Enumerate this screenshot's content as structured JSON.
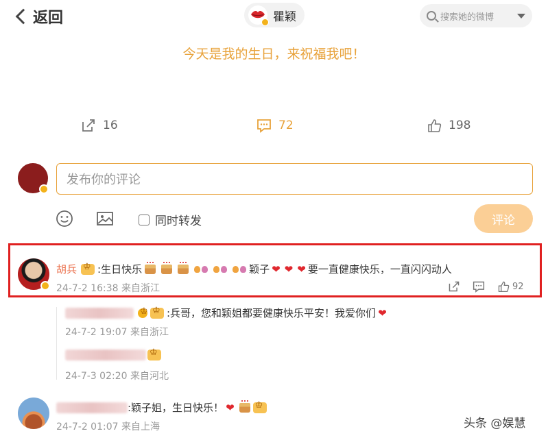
{
  "header": {
    "back_label": "返回",
    "user_name": "瞿颖",
    "search_placeholder": "搜索她的微博"
  },
  "post": {
    "text": "今天是我的生日，来祝福我吧！"
  },
  "actions": {
    "repost_count": "16",
    "comment_count": "72",
    "like_count": "198"
  },
  "composer": {
    "placeholder": "发布你的评论",
    "repost_label": "同时转发",
    "submit_label": "评论"
  },
  "comments": [
    {
      "author": "胡兵",
      "text_prefix": ":生日快乐",
      "text_name": "颖子",
      "text_suffix": "要一直健康快乐，一直闪闪动人",
      "time": "24-7-2 16:38 来自浙江",
      "likes": "92",
      "replies": [
        {
          "text": ":兵哥，您和颖姐都要健康快乐平安！我爱你们",
          "time": "24-7-2 19:07 来自浙江"
        },
        {
          "text": "",
          "time": "24-7-3 02:20 来自河北"
        }
      ]
    },
    {
      "author": "",
      "text": ":颖子姐，生日快乐！",
      "time": "24-7-2 01:07 来自上海"
    }
  ],
  "watermark": "头条 @娱慧",
  "colors": {
    "accent": "#e8a23a",
    "author_name": "#eb7350",
    "highlight_border": "#e02020",
    "submit_disabled": "#fbcf96"
  }
}
